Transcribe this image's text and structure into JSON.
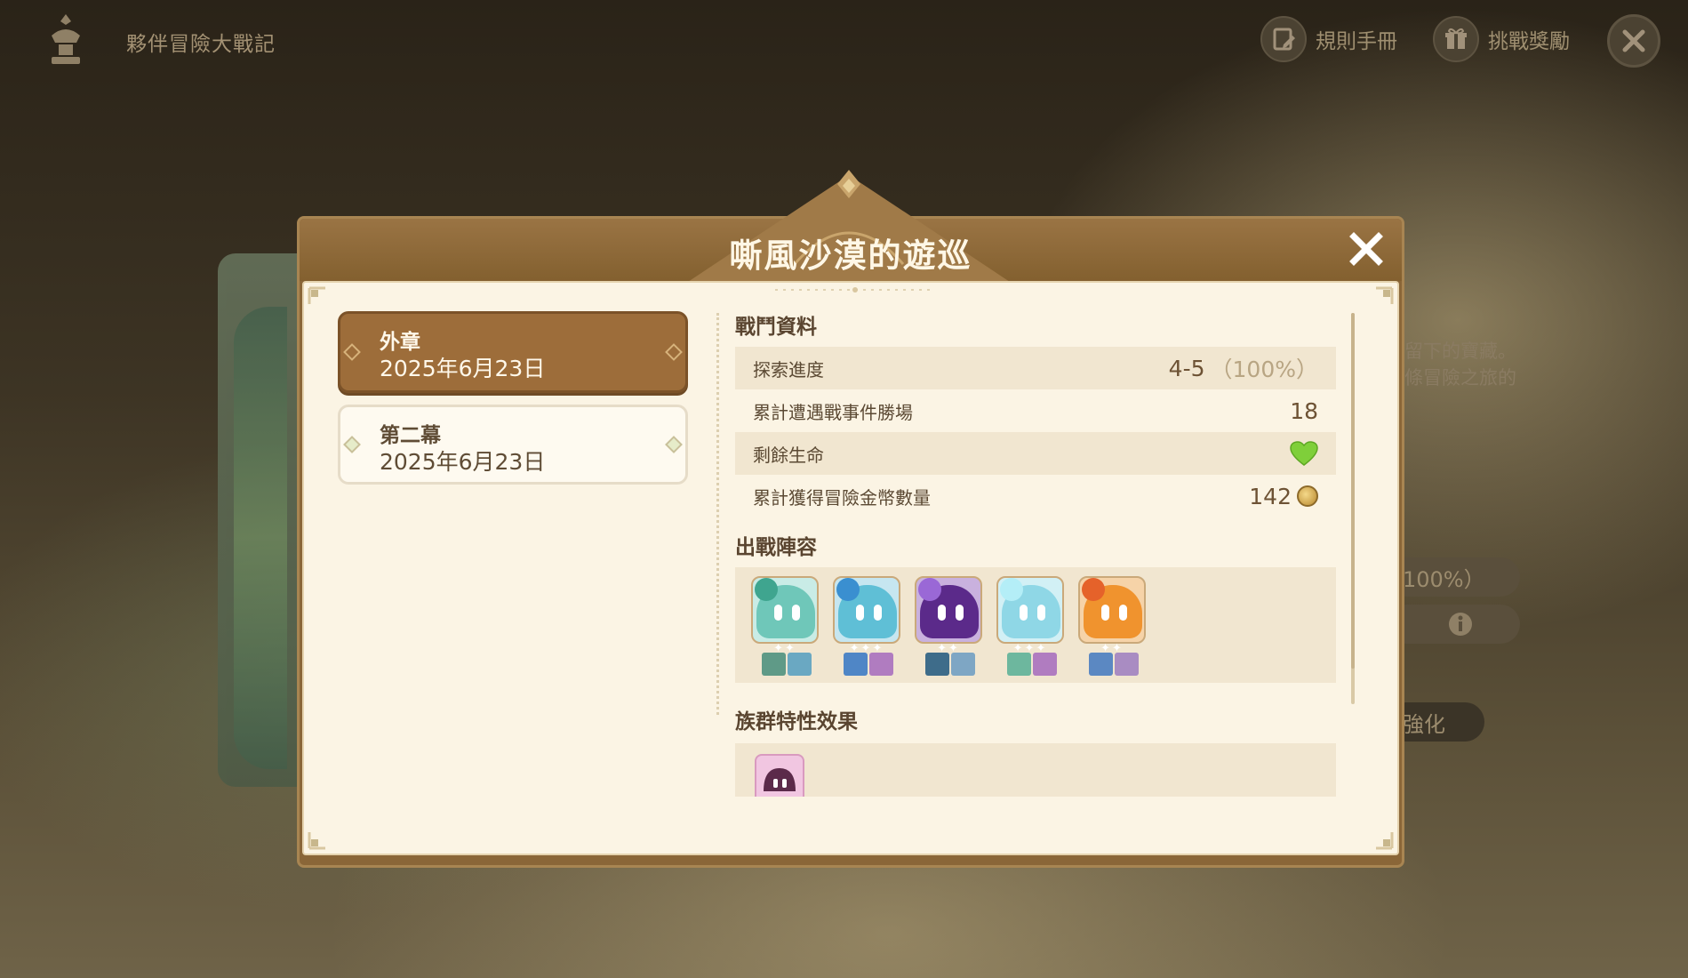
{
  "topbar": {
    "event_title": "夥伴冒險大戰記",
    "rules_label": "規則手冊",
    "rewards_label": "挑戰獎勵"
  },
  "background": {
    "right_text_line1": "留下的寶藏。",
    "right_text_line2": "條冒險之旅的",
    "pill1": "100%）",
    "pill3": "強化"
  },
  "modal": {
    "title": "嘶風沙漠的遊巡",
    "chapters": [
      {
        "name": "外章",
        "date": "2025年6月23日",
        "active": true
      },
      {
        "name": "第二幕",
        "date": "2025年6月23日",
        "active": false
      }
    ],
    "battle_section_title": "戰鬥資料",
    "stats": [
      {
        "label": "探索進度",
        "value": "4-5",
        "extra": "（100%）"
      },
      {
        "label": "累計遭遇戰事件勝場",
        "value": "18"
      },
      {
        "label": "剩餘生命",
        "value": ""
      },
      {
        "label": "累計獲得冒險金幣數量",
        "value": "142"
      }
    ],
    "lineup_section_title": "出戰陣容",
    "lineup": [
      {
        "element": "dendro",
        "color": "#6fc7b9",
        "accent": "#3fa58f"
      },
      {
        "element": "hydro",
        "color": "#5fbfd6",
        "accent": "#3a8fd0"
      },
      {
        "element": "electro",
        "color": "#5b2a8a",
        "accent": "#9a68d6"
      },
      {
        "element": "cryo",
        "color": "#8fd7e6",
        "accent": "#b4eef7"
      },
      {
        "element": "pyro",
        "color": "#f0932e",
        "accent": "#e5622a"
      }
    ],
    "traits_section_title": "族群特性效果"
  },
  "colors": {
    "frame": "#8a6638",
    "body_bg": "#fbf4e4",
    "active_chapter": "#9d6d3a",
    "heart": "#7fcf3a"
  }
}
